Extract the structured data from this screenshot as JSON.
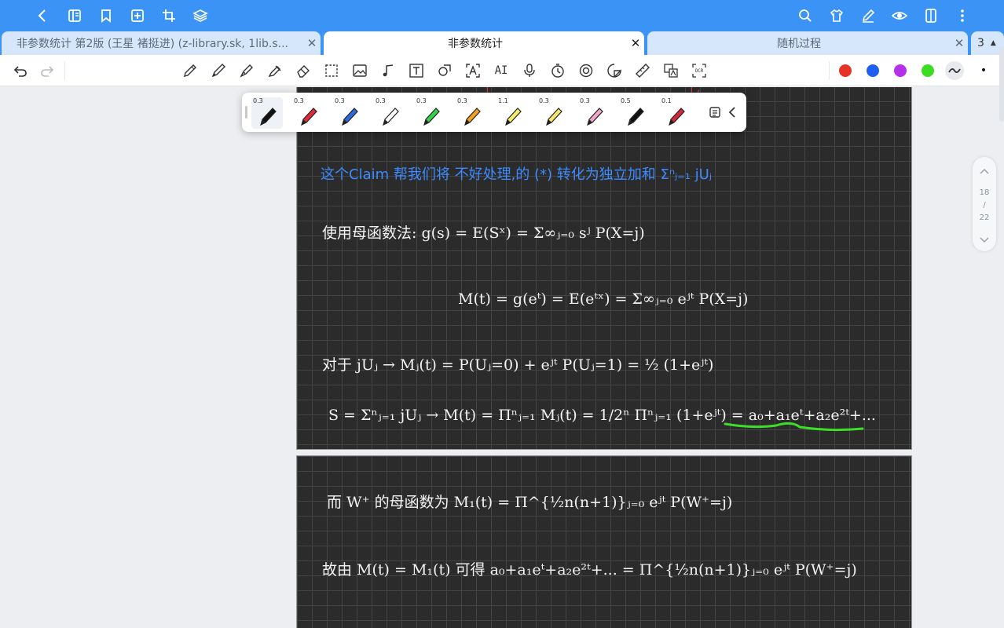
{
  "topbar": {
    "left_icons": [
      "back-chevron-icon",
      "book-icon",
      "bookmark-icon",
      "add-page-icon",
      "crop-icon",
      "layers-icon"
    ],
    "right_icons": [
      "search-icon",
      "shirt-icon",
      "pen-edit-icon",
      "eye-icon",
      "tablet-icon",
      "more-vertical-icon"
    ]
  },
  "tabs": [
    {
      "label": "非参数统计 第2版 (王星 褚挺进) (z-library.sk, 1lib.s...",
      "state": "inactive"
    },
    {
      "label": "非参数统计",
      "state": "active"
    },
    {
      "label": "随机过程",
      "state": "inactive"
    },
    {
      "label": "3",
      "state": "count"
    }
  ],
  "toolbar": {
    "tools": [
      "undo-icon",
      "redo-icon",
      "pencil-icon",
      "pen-icon",
      "fountain-pen-icon",
      "highlighter-icon",
      "eraser-icon",
      "lasso-select-icon",
      "image-icon",
      "music-icon",
      "text-box-icon",
      "shape-icon",
      "text-recognition-icon",
      "ai-icon",
      "microphone-icon",
      "timer-icon",
      "laser-pointer-icon",
      "sticker-icon",
      "ruler-icon",
      "translate-icon",
      "ocr-icon"
    ],
    "ai_label": "AI",
    "ocr_label": "OCR",
    "colors": [
      "#e53325",
      "#1f5ef0",
      "#b530e8",
      "#3bdc22"
    ],
    "more_label": "•"
  },
  "pen_popup": {
    "pens": [
      {
        "size": "0.3",
        "color": "#111111"
      },
      {
        "size": "0.3",
        "color": "#e02a3a"
      },
      {
        "size": "0.3",
        "color": "#2a6adb"
      },
      {
        "size": "0.3",
        "color": "#ffffff"
      },
      {
        "size": "0.3",
        "color": "#36d14a"
      },
      {
        "size": "0.3",
        "color": "#f3a021"
      },
      {
        "size": "1.1",
        "color": "#f3ee6a"
      },
      {
        "size": "0.3",
        "color": "#f6e56e"
      },
      {
        "size": "0.3",
        "color": "#f0a6c8"
      },
      {
        "size": "0.5",
        "color": "#111111"
      },
      {
        "size": "0.1",
        "color": "#d3283a"
      }
    ]
  },
  "page1": {
    "line1": "这个Claim 帮我们将 不好处理,的 (*) 转化为独立加和 Σⁿⱼ₌₁ jUⱼ",
    "line2": "使用母函数法:   g(s) = E(Sˣ) = Σ∞ⱼ₌₀ sʲ P(X=j)",
    "line3": "M(t) = g(eᵗ) = E(eᵗˣ) = Σ∞ⱼ₌₀ eʲᵗ P(X=j)",
    "line4": "对于 jUⱼ  →   Mⱼ(t) = P(Uⱼ=0) +  eʲᵗ P(Uⱼ=1)  = ½ (1+eʲᵗ)",
    "line5": "S = Σⁿⱼ₌₁ jUⱼ  →  M(t) = Πⁿⱼ₌₁ Mⱼ(t) = 1/2ⁿ Πⁿⱼ₌₁ (1+eʲᵗ) = a₀+a₁eᵗ+a₂e²ᵗ+..."
  },
  "page2": {
    "line1": "而 W⁺ 的母函数为   M₁(t) = Π^{½n(n+1)}ⱼ₌₀  eʲᵗ P(W⁺=j)",
    "line2": "故由 M(t) = M₁(t) 可得    a₀+a₁eᵗ+a₂e²ᵗ+... = Π^{½n(n+1)}ⱼ₌₀  eʲᵗ P(W⁺=j)"
  },
  "pager": {
    "current": "18",
    "separator": "/",
    "total": "22"
  }
}
